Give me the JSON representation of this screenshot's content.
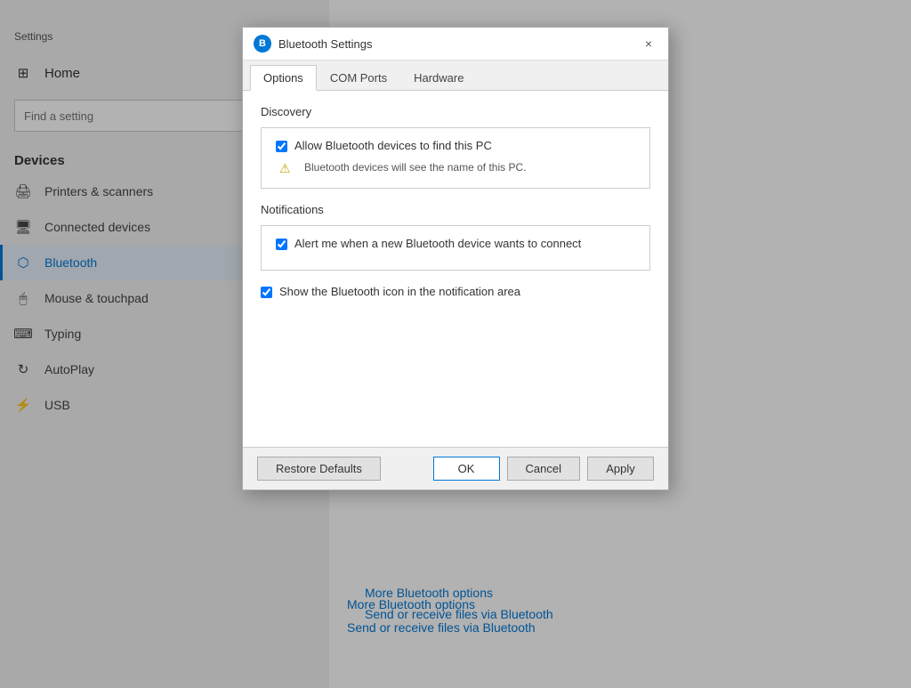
{
  "app": {
    "title": "Settings"
  },
  "sidebar": {
    "home_label": "Home",
    "search_placeholder": "Find a setting",
    "section_label": "Devices",
    "items": [
      {
        "id": "printers",
        "label": "Printers & scanners",
        "icon": "🖨"
      },
      {
        "id": "connected",
        "label": "Connected devices",
        "icon": "🖥"
      },
      {
        "id": "bluetooth",
        "label": "Bluetooth",
        "icon": "⬡",
        "active": true
      },
      {
        "id": "mouse",
        "label": "Mouse & touchpad",
        "icon": "🖱"
      },
      {
        "id": "typing",
        "label": "Typing",
        "icon": "⌨"
      },
      {
        "id": "autoplay",
        "label": "AutoPlay",
        "icon": "⟳"
      },
      {
        "id": "usb",
        "label": "USB",
        "icon": "⚡"
      }
    ]
  },
  "main": {
    "more_bluetooth_label": "More Bluetooth options",
    "send_receive_label": "Send or receive files via Bluetooth"
  },
  "dialog": {
    "title": "Bluetooth Settings",
    "close_label": "×",
    "tabs": [
      {
        "id": "options",
        "label": "Options",
        "active": true
      },
      {
        "id": "com_ports",
        "label": "COM Ports"
      },
      {
        "id": "hardware",
        "label": "Hardware"
      }
    ],
    "discovery_section": {
      "header": "Discovery",
      "allow_checkbox_label": "Allow Bluetooth devices to find this PC",
      "allow_checked": true,
      "warning_text": "Bluetooth devices will see the name of this PC."
    },
    "notifications_section": {
      "header": "Notifications",
      "alert_checkbox_label": "Alert me when a new Bluetooth device wants to connect",
      "alert_checked": true
    },
    "show_icon_checkbox_label": "Show the Bluetooth icon in the notification area",
    "show_icon_checked": true,
    "restore_defaults_label": "Restore Defaults",
    "ok_label": "OK",
    "cancel_label": "Cancel",
    "apply_label": "Apply"
  }
}
